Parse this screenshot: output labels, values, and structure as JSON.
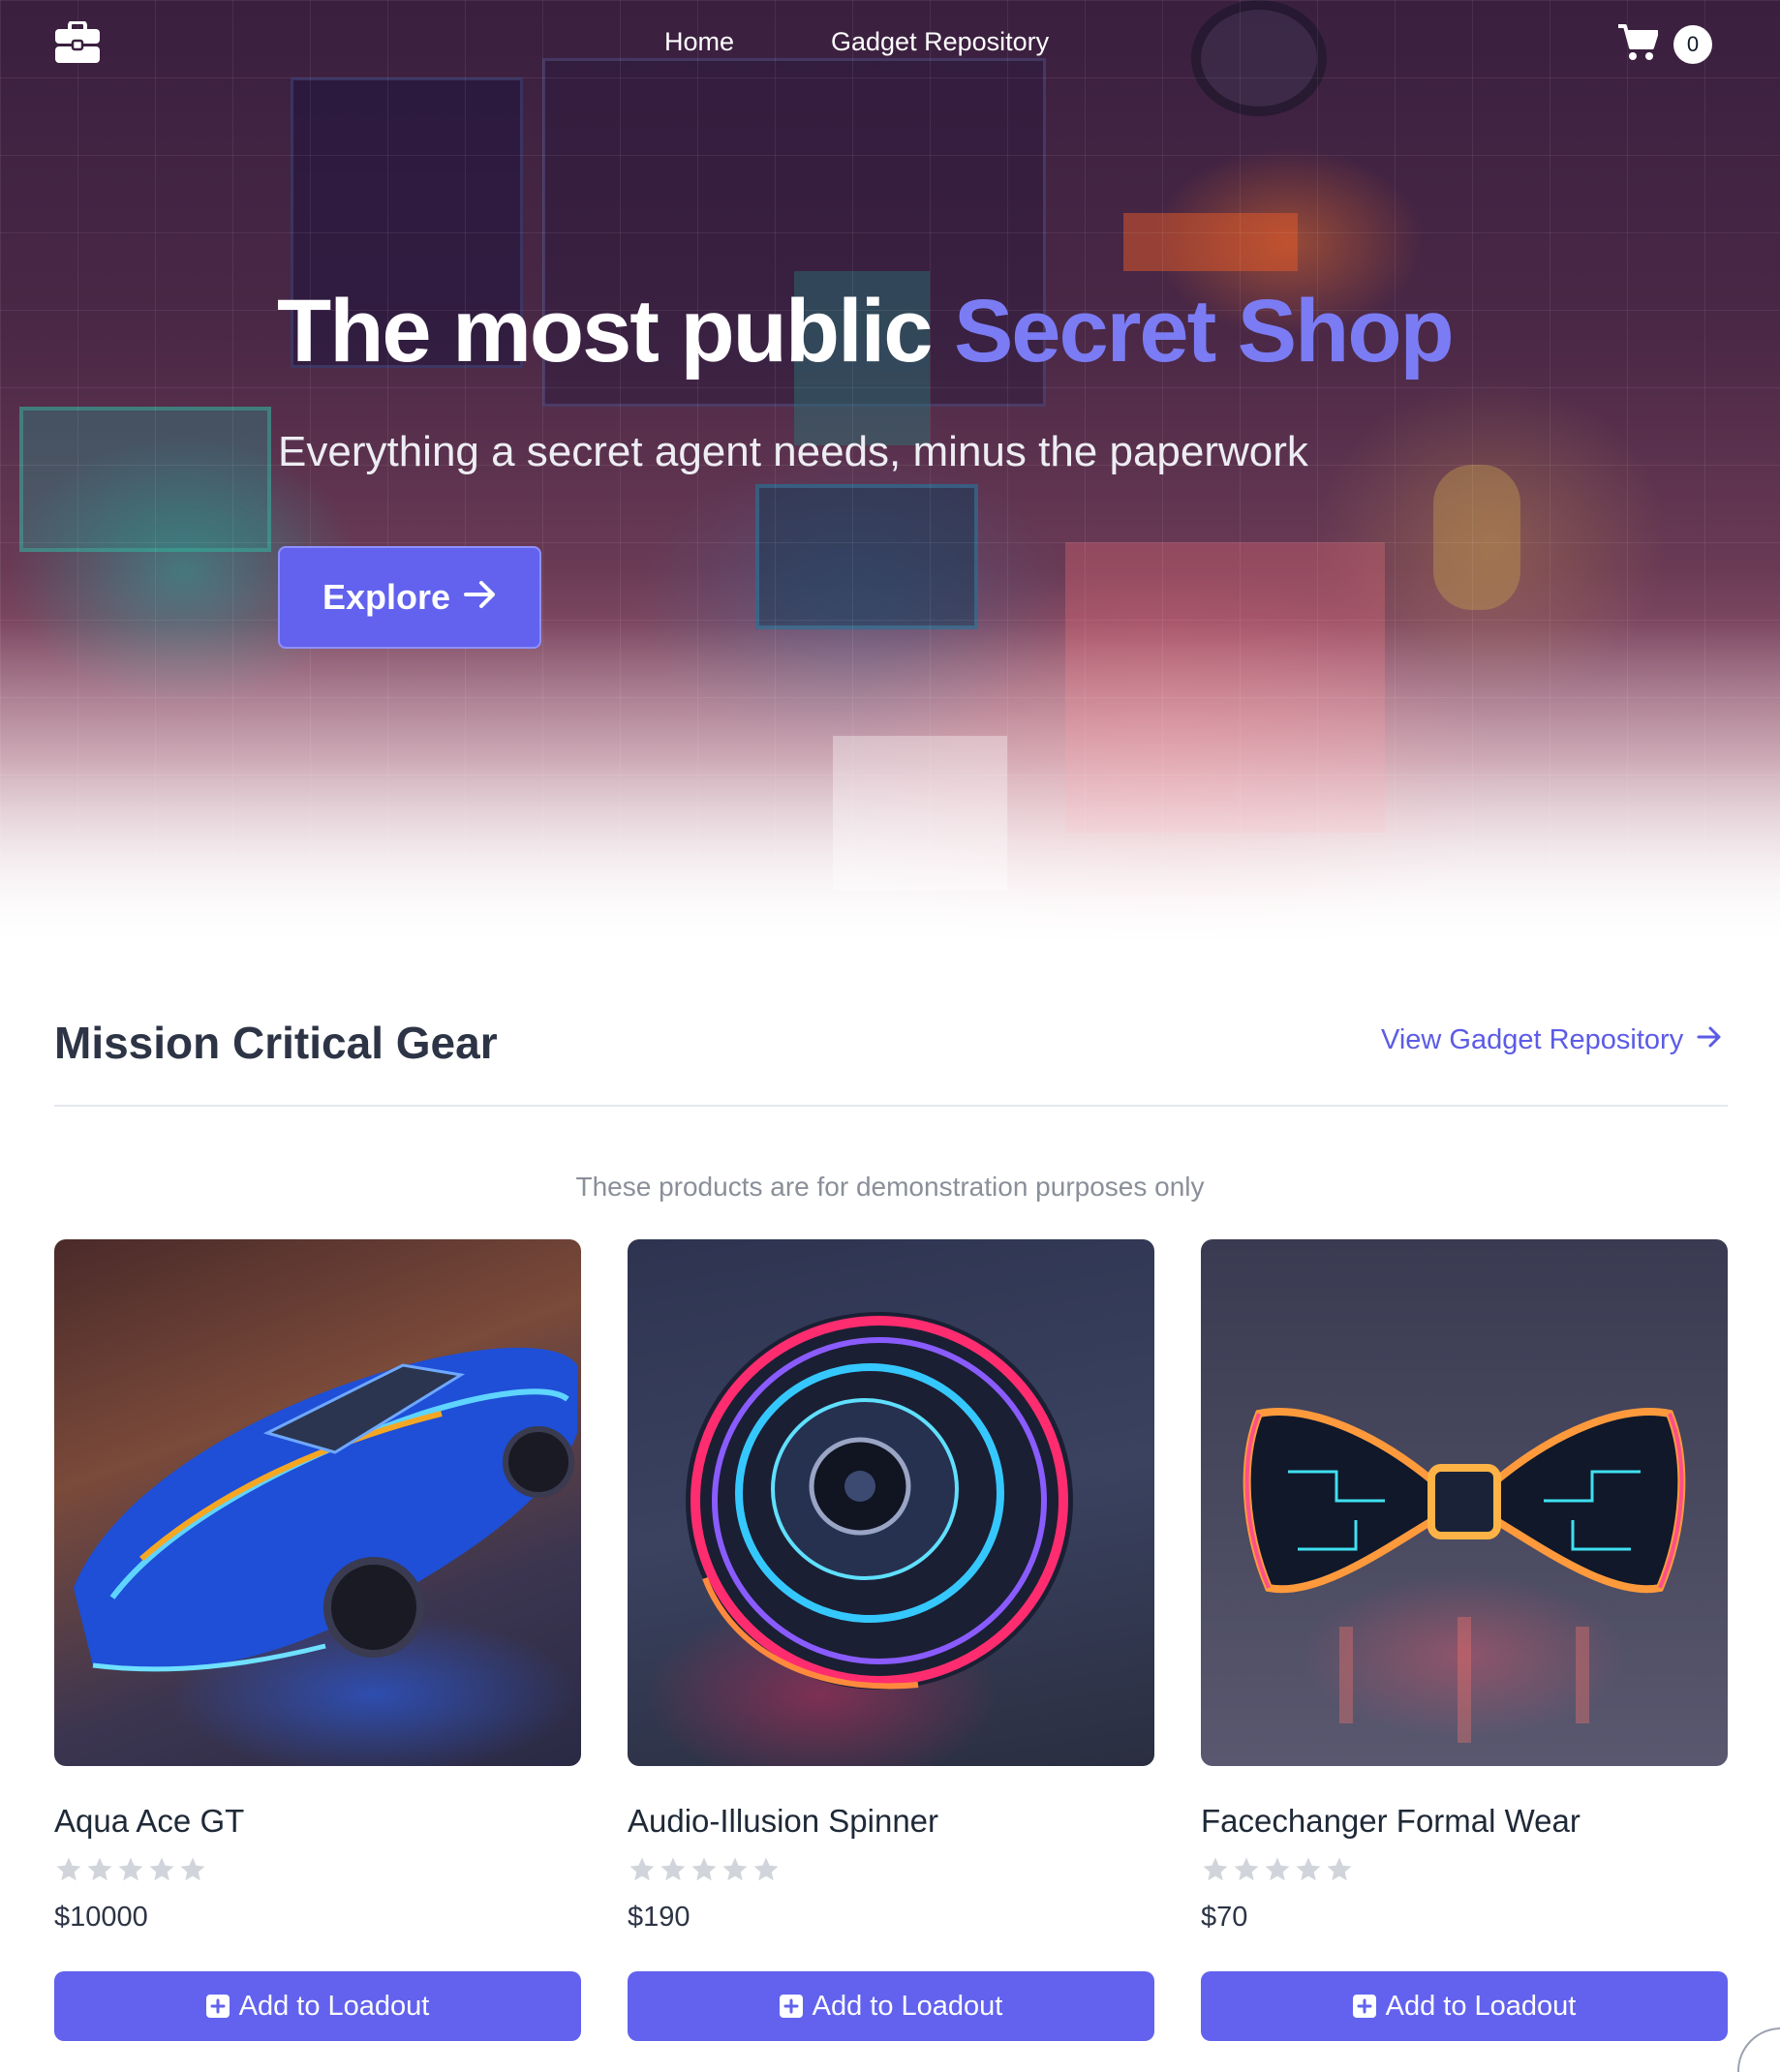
{
  "nav": {
    "links": [
      "Home",
      "Gadget Repository"
    ],
    "cart_count": "0",
    "logo_icon": "briefcase-icon",
    "cart_icon": "cart-icon"
  },
  "hero": {
    "headline_main": "The most public ",
    "headline_accent": "Secret Shop",
    "subhead": "Everything a secret agent needs, minus the paperwork",
    "cta_label": "Explore",
    "cta_icon": "arrow-right-icon",
    "accent_color": "#7b7cf4"
  },
  "section": {
    "title": "Mission Critical Gear",
    "view_all_label": "View Gadget Repository",
    "disclaimer": "These products are for demonstration purposes only"
  },
  "products": [
    {
      "name": "Aqua Ace GT",
      "price": "$10000",
      "rating": 0,
      "button": "Add to Loadout"
    },
    {
      "name": "Audio-Illusion Spinner",
      "price": "$190",
      "rating": 0,
      "button": "Add to Loadout"
    },
    {
      "name": "Facechanger Formal Wear",
      "price": "$70",
      "rating": 0,
      "button": "Add to Loadout"
    }
  ],
  "colors": {
    "primary": "#6262ee",
    "star_empty": "#d1d5db"
  }
}
